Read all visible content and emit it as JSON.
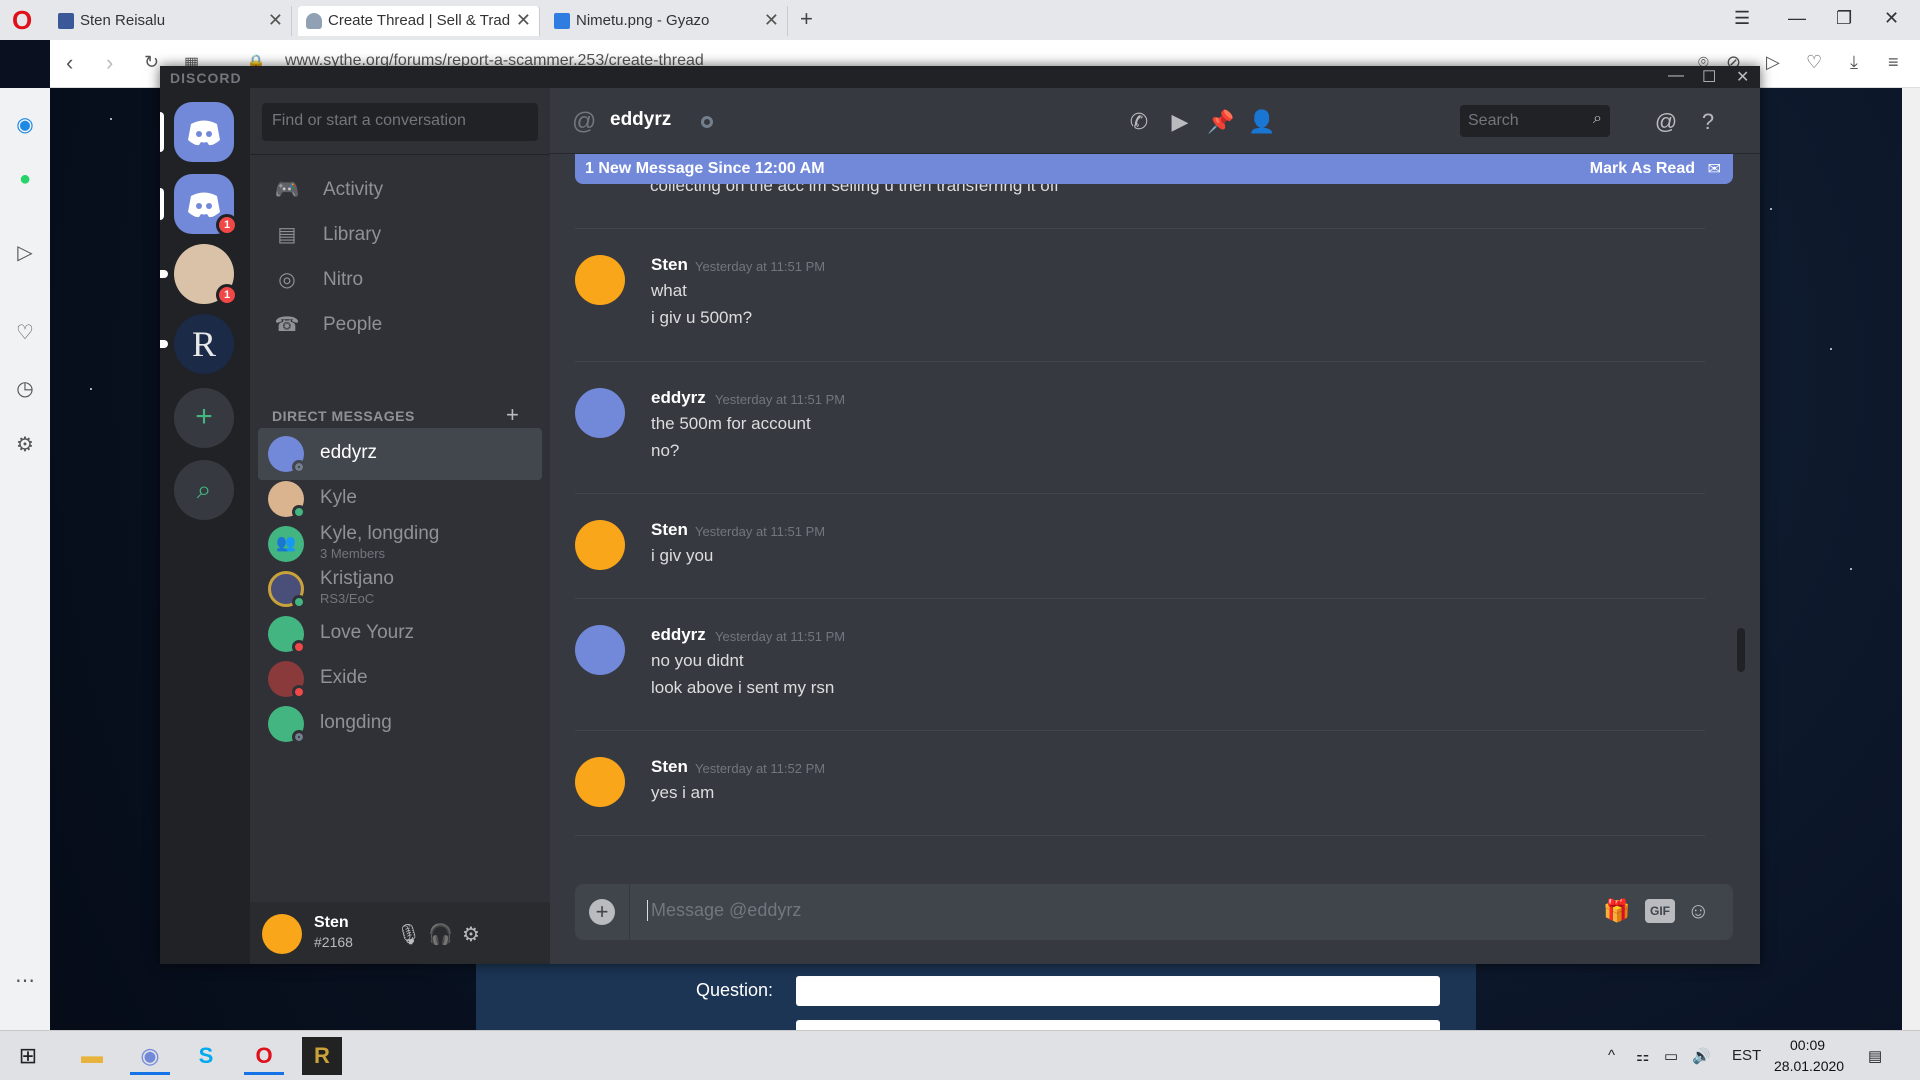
{
  "browser": {
    "tabs": [
      {
        "title": "Sten Reisalu"
      },
      {
        "title": "Create Thread | Sell & Trad"
      },
      {
        "title": "Nimetu.png - Gyazo"
      }
    ],
    "url": "www.sythe.org/forums/report-a-scammer.253/create-thread"
  },
  "forum": {
    "question_label": "Question:"
  },
  "discord": {
    "brand": "DISCORD",
    "guilds": [
      {
        "name": "home",
        "badge": ""
      },
      {
        "name": "server-1",
        "badge": "1"
      },
      {
        "name": "server-2",
        "badge": "1"
      },
      {
        "name": "server-runescape",
        "badge": ""
      }
    ],
    "find_placeholder": "Find or start a conversation",
    "nav": [
      {
        "label": "Activity",
        "icon": "gamepad-icon"
      },
      {
        "label": "Library",
        "icon": "library-icon"
      },
      {
        "label": "Nitro",
        "icon": "nitro-icon"
      },
      {
        "label": "People",
        "icon": "people-icon"
      }
    ],
    "dm_header": "DIRECT MESSAGES",
    "dms": [
      {
        "name": "eddyrz",
        "sub": "",
        "status": "offline",
        "avatar_color": "#7289da",
        "active": true
      },
      {
        "name": "Kyle",
        "sub": "",
        "status": "online",
        "avatar_color": "#d9b48f"
      },
      {
        "name": "Kyle, longding",
        "sub": "3 Members",
        "status": "",
        "avatar_color": "#43b581"
      },
      {
        "name": "Kristjano",
        "sub": "RS3/EoC",
        "status": "online",
        "avatar_color": "#4a4f7a"
      },
      {
        "name": "Love Yourz",
        "sub": "",
        "status": "dnd",
        "avatar_color": "#43b581"
      },
      {
        "name": "Exide",
        "sub": "",
        "status": "dnd",
        "avatar_color": "#8a3a3a"
      },
      {
        "name": "longding",
        "sub": "",
        "status": "offline",
        "avatar_color": "#43b581"
      }
    ],
    "user": {
      "name": "Sten",
      "tag": "#2168"
    },
    "chat": {
      "title": "eddyrz",
      "search_placeholder": "Search",
      "banner_text": "1 New Message Since 12:00 AM",
      "banner_action": "Mark As Read",
      "previous_line": "collecting on the acc im selling u then transferring it off",
      "messages": [
        {
          "author": "Sten",
          "time": "Yesterday at 11:51 PM",
          "lines": [
            "what",
            "i giv u 500m?"
          ],
          "avatar_color": "#faa61a"
        },
        {
          "author": "eddyrz",
          "time": "Yesterday at 11:51 PM",
          "lines": [
            "the 500m for account",
            "no?"
          ],
          "avatar_color": "#7289da"
        },
        {
          "author": "Sten",
          "time": "Yesterday at 11:51 PM",
          "lines": [
            "i giv you"
          ],
          "avatar_color": "#faa61a"
        },
        {
          "author": "eddyrz",
          "time": "Yesterday at 11:51 PM",
          "lines": [
            "no you didnt",
            "look above i sent my rsn"
          ],
          "avatar_color": "#7289da"
        },
        {
          "author": "Sten",
          "time": "Yesterday at 11:52 PM",
          "lines": [
            "yes i am"
          ],
          "avatar_color": "#faa61a"
        }
      ],
      "composer_placeholder": "Message @eddyrz",
      "gif_label": "GIF"
    }
  },
  "taskbar": {
    "lang": "EST",
    "time": "00:09",
    "date": "28.01.2020"
  }
}
